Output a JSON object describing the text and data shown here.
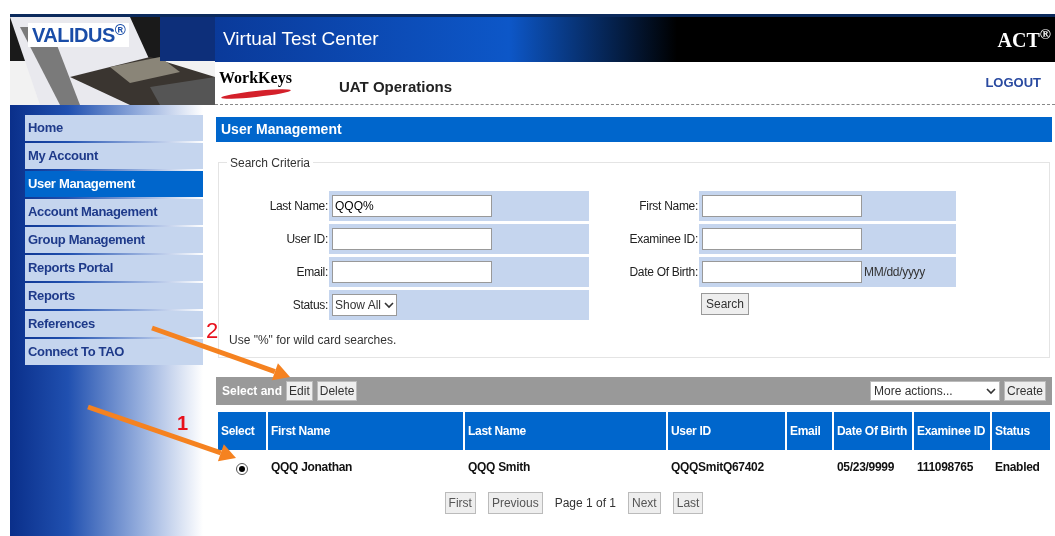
{
  "header": {
    "brand": "VALIDUS$^{®}$",
    "title": "Virtual Test Center",
    "corporate_logo": "ACT$^{®}$",
    "product_logo": "WorkKeys",
    "app_name": "UAT Operations",
    "logout": "LOGOUT"
  },
  "sidebar": {
    "items": [
      {
        "label": "Home",
        "selected": false
      },
      {
        "label": "My Account",
        "selected": false
      },
      {
        "label": "User Management",
        "selected": true
      },
      {
        "label": "Account Management",
        "selected": false
      },
      {
        "label": "Group Management",
        "selected": false
      },
      {
        "label": "Reports Portal",
        "selected": false
      },
      {
        "label": "Reports",
        "selected": false
      },
      {
        "label": "References",
        "selected": false
      },
      {
        "label": "Connect To TAO",
        "selected": false
      }
    ]
  },
  "panel": {
    "title": "User Management",
    "search_criteria": {
      "legend": "Search Criteria",
      "left_fields": [
        {
          "label": "Last Name:",
          "kind": "text",
          "value": "QQQ%"
        },
        {
          "label": "User ID:",
          "kind": "text"
        },
        {
          "label": "Email:",
          "kind": "text"
        },
        {
          "label": "Status:",
          "kind": "select",
          "value": "Show All"
        }
      ],
      "right_fields": [
        {
          "label": "First Name:",
          "kind": "text"
        },
        {
          "label": "Examinee ID:",
          "kind": "text"
        },
        {
          "label": "Date Of Birth:",
          "kind": "text",
          "format": "MM/dd/yyyy"
        }
      ],
      "search_button": "Search",
      "note": "Use \"%\" for wild card searches."
    },
    "toolbar": {
      "label": "Select and",
      "buttons": [
        "Edit",
        "Delete"
      ],
      "actions_select": "More actions...",
      "create_button": "Create"
    },
    "table": {
      "columns": [
        "Select",
        "First Name",
        "Last Name",
        "User ID",
        "Email",
        "Date Of Birth",
        "Examinee ID",
        "Status"
      ],
      "rows": [
        {
          "selected": true,
          "cells": [
            "",
            "QQQ Jonathan",
            "QQQ Smith",
            "QQQSmitQ67402",
            "",
            "05/23/9999",
            "111098765",
            "Enabled"
          ]
        }
      ]
    },
    "pagination": {
      "first": "First",
      "previous": "Previous",
      "info": "Page 1 of 1",
      "next": "Next",
      "last": "Last"
    }
  },
  "annotations": [
    {
      "label": "2"
    },
    {
      "label": "1"
    }
  ]
}
